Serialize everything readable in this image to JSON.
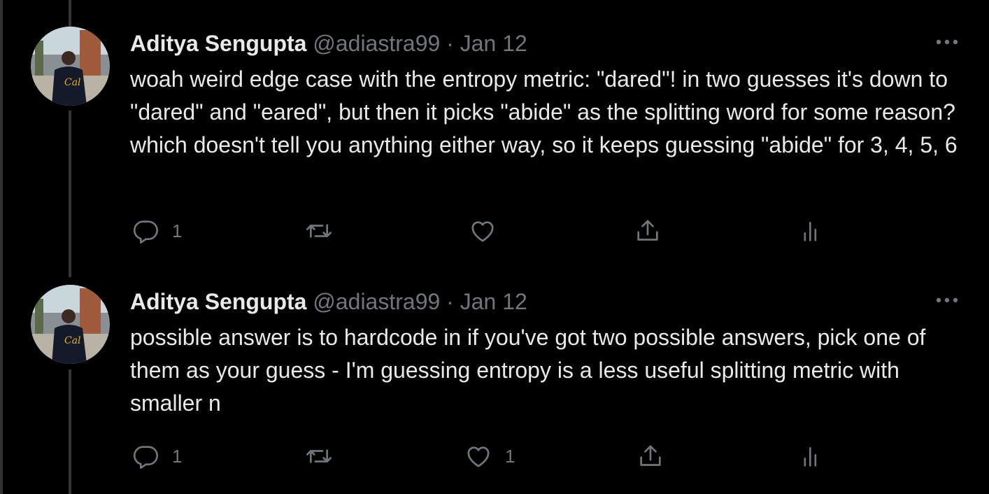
{
  "tweets": [
    {
      "author": "Aditya Sengupta",
      "handle": "@adiastra99",
      "separator": "·",
      "date": "Jan 12",
      "text": "woah weird edge case with the entropy metric: \"dared\"! in two guesses it's down to \"dared\" and \"eared\", but then it picks \"abide\" as the splitting word for some reason? which doesn't tell you anything either way, so it keeps guessing \"abide\" for 3, 4, 5, 6",
      "reply_count": "1",
      "retweet_count": "",
      "like_count": ""
    },
    {
      "author": "Aditya Sengupta",
      "handle": "@adiastra99",
      "separator": "·",
      "date": "Jan 12",
      "text": "possible answer is to hardcode in if you've got two possible answers, pick one of them as your guess - I'm guessing entropy is a less useful splitting metric with smaller n",
      "reply_count": "1",
      "retweet_count": "",
      "like_count": "1"
    }
  ],
  "icons": {
    "reply": "reply-icon",
    "retweet": "retweet-icon",
    "like": "heart-icon",
    "share": "share-icon",
    "analytics": "analytics-icon",
    "more": "more-icon"
  },
  "colors": {
    "background": "#000000",
    "text": "#e7e9ea",
    "secondary": "#71767b",
    "thread_line": "#333639"
  }
}
